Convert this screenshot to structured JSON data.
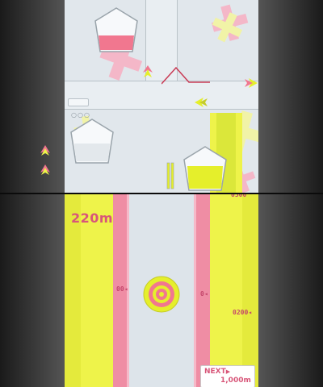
{
  "hud": {
    "distance": "220m",
    "next_label": "NEXT",
    "next_arrow": "▶",
    "next_value": "1,000m",
    "marker_top_right": "0500",
    "marker_mid_left": "00◂",
    "marker_mid_center": "0◂",
    "marker_lower_right": "0200◂"
  },
  "lives": {
    "count": 2
  },
  "gauges": {
    "top": {
      "fill": 0.3,
      "color": "#f1778f"
    },
    "left": {
      "fill": 0.0,
      "color": "#cfd6dc"
    },
    "right": {
      "fill": 0.5,
      "color": "#e5ef2b"
    }
  },
  "colors": {
    "pink": "#f1778f",
    "yellow": "#eef34a",
    "road": "#dde4ea",
    "text_pink": "#d85679"
  },
  "icons": [
    "arrow-ship-icon",
    "target-ring-icon",
    "life-arrow-icon"
  ]
}
